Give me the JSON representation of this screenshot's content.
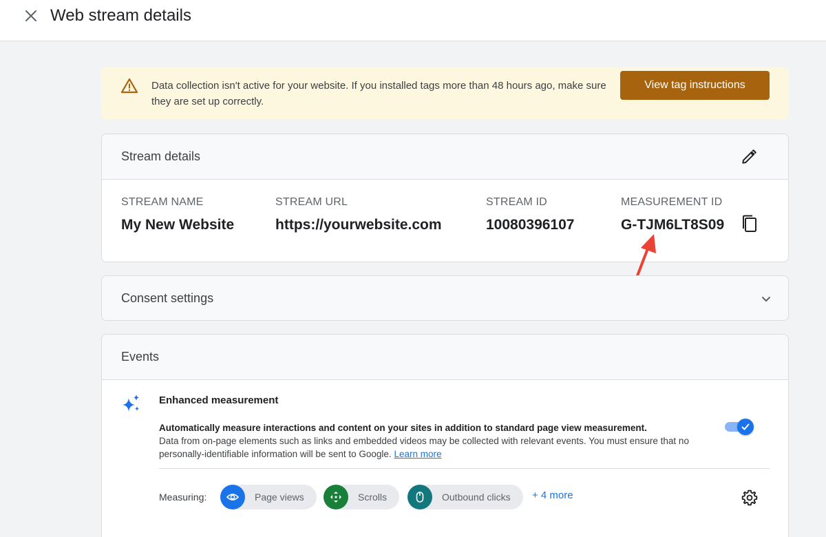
{
  "header": {
    "title": "Web stream details"
  },
  "banner": {
    "message": "Data collection isn't active for your website. If you installed tags more than 48 hours ago, make sure they are set up correctly.",
    "button_label": "View tag instructions",
    "accent": "#a8630f",
    "background": "#fef7e0"
  },
  "stream_details": {
    "title": "Stream details",
    "fields": [
      {
        "label": "STREAM NAME",
        "value": "My New Website"
      },
      {
        "label": "STREAM URL",
        "value": "https://yourwebsite.com"
      },
      {
        "label": "STREAM ID",
        "value": "10080396107"
      },
      {
        "label": "MEASUREMENT ID",
        "value": "G-TJM6LT8S09"
      }
    ]
  },
  "consent": {
    "title": "Consent settings"
  },
  "events": {
    "title": "Events",
    "enhanced": {
      "title": "Enhanced measurement",
      "desc_strong": "Automatically measure interactions and content on your sites in addition to standard page view measurement.",
      "desc": "Data from on-page elements such as links and embedded videos may be collected with relevant events. You must ensure that no personally-identifiable information will be sent to Google.",
      "learn_more": "Learn more",
      "enabled": true
    },
    "measuring_label": "Measuring:",
    "chips": [
      {
        "label": "Page views",
        "icon": "eye-icon",
        "color": "#1a73e8"
      },
      {
        "label": "Scrolls",
        "icon": "scroll-arrows-icon",
        "color": "#188038"
      },
      {
        "label": "Outbound clicks",
        "icon": "mouse-icon",
        "color": "#12787e"
      }
    ],
    "more_label": "+ 4 more"
  },
  "annotation": {
    "arrow_color": "#ea4335"
  }
}
